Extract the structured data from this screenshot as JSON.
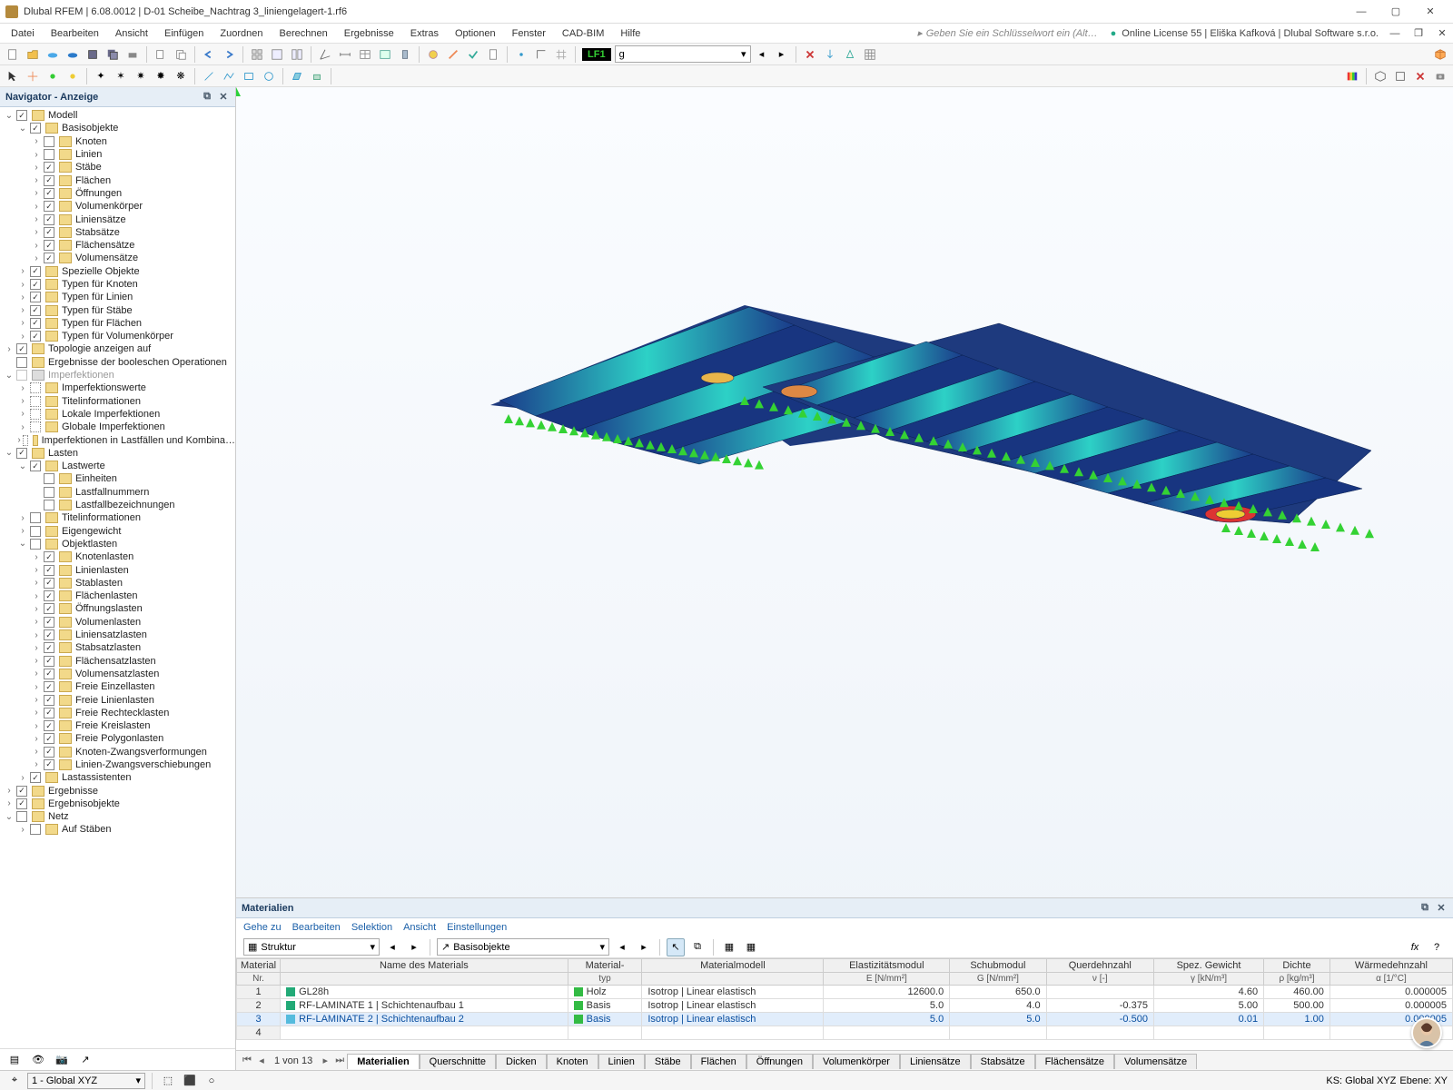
{
  "title": "Dlubal RFEM | 6.08.0012 | D-01 Scheibe_Nachtrag 3_liniengelagert-1.rf6",
  "search_placeholder": "Geben Sie ein Schlüsselwort ein (Alt…",
  "license": "Online License 55 | Eliška Kafková | Dlubal Software s.r.o.",
  "menu": [
    "Datei",
    "Bearbeiten",
    "Ansicht",
    "Einfügen",
    "Zuordnen",
    "Berechnen",
    "Ergebnisse",
    "Extras",
    "Optionen",
    "Fenster",
    "CAD-BIM",
    "Hilfe"
  ],
  "lf_tag": "LF1",
  "lf_value": "g",
  "nav_title": "Navigator - Anzeige",
  "tree": [
    {
      "d": 0,
      "tw": "v",
      "cb": true,
      "lbl": "Modell"
    },
    {
      "d": 1,
      "tw": "v",
      "cb": true,
      "lbl": "Basisobjekte"
    },
    {
      "d": 2,
      "tw": ">",
      "cb": false,
      "lbl": "Knoten"
    },
    {
      "d": 2,
      "tw": ">",
      "cb": false,
      "lbl": "Linien"
    },
    {
      "d": 2,
      "tw": ">",
      "cb": true,
      "lbl": "Stäbe"
    },
    {
      "d": 2,
      "tw": ">",
      "cb": true,
      "lbl": "Flächen"
    },
    {
      "d": 2,
      "tw": ">",
      "cb": true,
      "lbl": "Öffnungen"
    },
    {
      "d": 2,
      "tw": ">",
      "cb": true,
      "lbl": "Volumenkörper"
    },
    {
      "d": 2,
      "tw": ">",
      "cb": true,
      "lbl": "Liniensätze"
    },
    {
      "d": 2,
      "tw": ">",
      "cb": true,
      "lbl": "Stabsätze"
    },
    {
      "d": 2,
      "tw": ">",
      "cb": true,
      "lbl": "Flächensätze"
    },
    {
      "d": 2,
      "tw": ">",
      "cb": true,
      "lbl": "Volumensätze"
    },
    {
      "d": 1,
      "tw": ">",
      "cb": true,
      "lbl": "Spezielle Objekte"
    },
    {
      "d": 1,
      "tw": ">",
      "cb": true,
      "lbl": "Typen für Knoten"
    },
    {
      "d": 1,
      "tw": ">",
      "cb": true,
      "lbl": "Typen für Linien"
    },
    {
      "d": 1,
      "tw": ">",
      "cb": true,
      "lbl": "Typen für Stäbe"
    },
    {
      "d": 1,
      "tw": ">",
      "cb": true,
      "lbl": "Typen für Flächen"
    },
    {
      "d": 1,
      "tw": ">",
      "cb": true,
      "lbl": "Typen für Volumenkörper"
    },
    {
      "d": 0,
      "tw": ">",
      "cb": true,
      "lbl": "Topologie anzeigen auf"
    },
    {
      "d": 0,
      "tw": "",
      "cb": false,
      "lbl": "Ergebnisse der booleschen Operationen"
    },
    {
      "d": 0,
      "tw": "v",
      "cb": false,
      "grey": true,
      "lbl": "Imperfektionen"
    },
    {
      "d": 1,
      "tw": ">",
      "cb": "",
      "grey": false,
      "lbl": "Imperfektionswerte",
      "sp": true
    },
    {
      "d": 1,
      "tw": ">",
      "cb": "",
      "lbl": "Titelinformationen",
      "sp": true
    },
    {
      "d": 1,
      "tw": ">",
      "cb": "",
      "lbl": "Lokale Imperfektionen",
      "sp": true
    },
    {
      "d": 1,
      "tw": ">",
      "cb": "",
      "lbl": "Globale Imperfektionen",
      "sp": true
    },
    {
      "d": 1,
      "tw": ">",
      "cb": "",
      "lbl": "Imperfektionen in Lastfällen und Kombina…",
      "sp": true
    },
    {
      "d": 0,
      "tw": "v",
      "cb": true,
      "lbl": "Lasten"
    },
    {
      "d": 1,
      "tw": "v",
      "cb": true,
      "lbl": "Lastwerte"
    },
    {
      "d": 2,
      "tw": "",
      "cb": false,
      "lbl": "Einheiten"
    },
    {
      "d": 2,
      "tw": "",
      "cb": false,
      "lbl": "Lastfallnummern"
    },
    {
      "d": 2,
      "tw": "",
      "cb": false,
      "lbl": "Lastfallbezeichnungen"
    },
    {
      "d": 1,
      "tw": ">",
      "cb": false,
      "lbl": "Titelinformationen"
    },
    {
      "d": 1,
      "tw": ">",
      "cb": false,
      "lbl": "Eigengewicht"
    },
    {
      "d": 1,
      "tw": "v",
      "cb": false,
      "lbl": "Objektlasten"
    },
    {
      "d": 2,
      "tw": ">",
      "cb": true,
      "lbl": "Knotenlasten"
    },
    {
      "d": 2,
      "tw": ">",
      "cb": true,
      "lbl": "Linienlasten"
    },
    {
      "d": 2,
      "tw": ">",
      "cb": true,
      "lbl": "Stablasten"
    },
    {
      "d": 2,
      "tw": ">",
      "cb": true,
      "lbl": "Flächenlasten"
    },
    {
      "d": 2,
      "tw": ">",
      "cb": true,
      "lbl": "Öffnungslasten"
    },
    {
      "d": 2,
      "tw": ">",
      "cb": true,
      "lbl": "Volumenlasten"
    },
    {
      "d": 2,
      "tw": ">",
      "cb": true,
      "lbl": "Liniensatzlasten"
    },
    {
      "d": 2,
      "tw": ">",
      "cb": true,
      "lbl": "Stabsatzlasten"
    },
    {
      "d": 2,
      "tw": ">",
      "cb": true,
      "lbl": "Flächensatzlasten"
    },
    {
      "d": 2,
      "tw": ">",
      "cb": true,
      "lbl": "Volumensatzlasten"
    },
    {
      "d": 2,
      "tw": ">",
      "cb": true,
      "lbl": "Freie Einzellasten"
    },
    {
      "d": 2,
      "tw": ">",
      "cb": true,
      "lbl": "Freie Linienlasten"
    },
    {
      "d": 2,
      "tw": ">",
      "cb": true,
      "lbl": "Freie Rechtecklasten"
    },
    {
      "d": 2,
      "tw": ">",
      "cb": true,
      "lbl": "Freie Kreislasten"
    },
    {
      "d": 2,
      "tw": ">",
      "cb": true,
      "lbl": "Freie Polygonlasten"
    },
    {
      "d": 2,
      "tw": ">",
      "cb": true,
      "lbl": "Knoten-Zwangsverformungen"
    },
    {
      "d": 2,
      "tw": ">",
      "cb": true,
      "lbl": "Linien-Zwangsverschiebungen"
    },
    {
      "d": 1,
      "tw": ">",
      "cb": true,
      "lbl": "Lastassistenten"
    },
    {
      "d": 0,
      "tw": ">",
      "cb": true,
      "lbl": "Ergebnisse"
    },
    {
      "d": 0,
      "tw": ">",
      "cb": true,
      "lbl": "Ergebnisobjekte"
    },
    {
      "d": 0,
      "tw": "v",
      "cb": false,
      "lbl": "Netz"
    },
    {
      "d": 1,
      "tw": ">",
      "cb": false,
      "lbl": "Auf Stäben"
    }
  ],
  "bp_title": "Materialien",
  "bp_menu": [
    "Gehe zu",
    "Bearbeiten",
    "Selektion",
    "Ansicht",
    "Einstellungen"
  ],
  "bp_combo1": "Struktur",
  "bp_combo2": "Basisobjekte",
  "grid_hdr1": [
    "Material\nNr.",
    "Name des Materials",
    "Material-\ntyp",
    "Materialmodell",
    "Elastizitätsmodul\nE [N/mm²]",
    "Schubmodul\nG [N/mm²]",
    "Querdehnzahl\nν [-]",
    "Spez. Gewicht\nγ [kN/m³]",
    "Dichte\nρ [kg/m³]",
    "Wärmedehnzahl\nα [1/°C]"
  ],
  "grid_rows": [
    {
      "n": "1",
      "name": "GL28h",
      "typ": "Holz",
      "model": "Isotrop | Linear elastisch",
      "e": "12600.0",
      "g": "650.0",
      "v": "",
      "gw": "4.60",
      "d": "460.00",
      "a": "0.000005"
    },
    {
      "n": "2",
      "name": "RF-LAMINATE 1 | Schichtenaufbau 1",
      "typ": "Basis",
      "model": "Isotrop | Linear elastisch",
      "e": "5.0",
      "g": "4.0",
      "v": "-0.375",
      "gw": "5.00",
      "d": "500.00",
      "a": "0.000005"
    },
    {
      "n": "3",
      "name": "RF-LAMINATE 2 | Schichtenaufbau 2",
      "typ": "Basis",
      "model": "Isotrop | Linear elastisch",
      "e": "5.0",
      "g": "5.0",
      "v": "-0.500",
      "gw": "0.01",
      "d": "1.00",
      "a": "0.000005",
      "sel": true
    },
    {
      "n": "4",
      "name": "",
      "typ": "",
      "model": "",
      "e": "",
      "g": "",
      "v": "",
      "gw": "",
      "d": "",
      "a": ""
    }
  ],
  "pager": "1 von 13",
  "tabs": [
    "Materialien",
    "Querschnitte",
    "Dicken",
    "Knoten",
    "Linien",
    "Stäbe",
    "Flächen",
    "Öffnungen",
    "Volumenkörper",
    "Liniensätze",
    "Stabsätze",
    "Flächensätze",
    "Volumensätze"
  ],
  "status_ks": "KS: Global XYZ",
  "status_ebene": "Ebene: XY",
  "bb_coord": "1 - Global XYZ"
}
